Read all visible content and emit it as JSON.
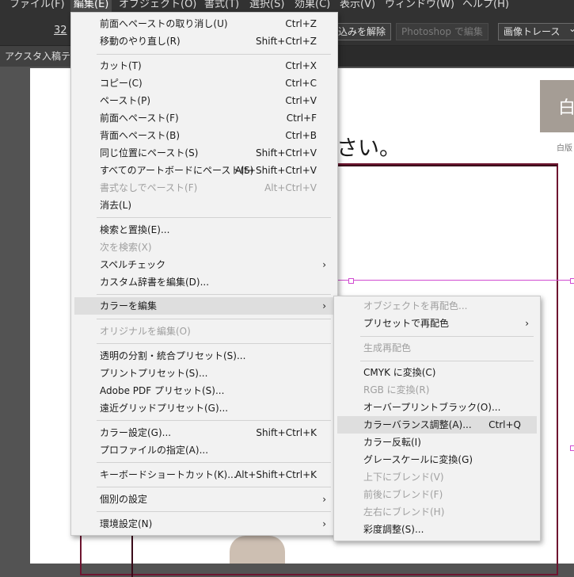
{
  "menubar": {
    "items": [
      {
        "label": "ファイル(F)"
      },
      {
        "label": "編集(E)"
      },
      {
        "label": "オブジェクト(O)"
      },
      {
        "label": "書式(T)"
      },
      {
        "label": "選択(S)"
      },
      {
        "label": "効果(C)"
      },
      {
        "label": "表示(V)"
      },
      {
        "label": "ウィンドウ(W)"
      },
      {
        "label": "ヘルプ(H)"
      }
    ]
  },
  "controlbar": {
    "number": "32",
    "release_button": "込みを解除",
    "photoshop_button": "Photoshop で編集",
    "image_trace_button": "画像トレース",
    "image_trace_arrow": "⌄"
  },
  "document_tab": {
    "title": "アクスタ入稿テン"
  },
  "artboard": {
    "heading_text": "さい。",
    "swatch_text": "白",
    "swatch_label": "白版"
  },
  "edit_menu": {
    "items": [
      {
        "label": "前面へペーストの取り消し(U)",
        "shortcut": "Ctrl+Z"
      },
      {
        "label": "移動のやり直し(R)",
        "shortcut": "Shift+Ctrl+Z"
      },
      {
        "label": "カット(T)",
        "shortcut": "Ctrl+X"
      },
      {
        "label": "コピー(C)",
        "shortcut": "Ctrl+C"
      },
      {
        "label": "ペースト(P)",
        "shortcut": "Ctrl+V"
      },
      {
        "label": "前面へペースト(F)",
        "shortcut": "Ctrl+F"
      },
      {
        "label": "背面へペースト(B)",
        "shortcut": "Ctrl+B"
      },
      {
        "label": "同じ位置にペースト(S)",
        "shortcut": "Shift+Ctrl+V"
      },
      {
        "label": "すべてのアートボードにペースト(S)",
        "shortcut": "Alt+Shift+Ctrl+V"
      },
      {
        "label": "書式なしでペースト(F)",
        "shortcut": "Alt+Ctrl+V"
      },
      {
        "label": "消去(L)",
        "shortcut": ""
      },
      {
        "label": "検索と置換(E)...",
        "shortcut": ""
      },
      {
        "label": "次を検索(X)",
        "shortcut": ""
      },
      {
        "label": "スペルチェック",
        "shortcut": ""
      },
      {
        "label": "カスタム辞書を編集(D)...",
        "shortcut": ""
      },
      {
        "label": "カラーを編集",
        "shortcut": ""
      },
      {
        "label": "オリジナルを編集(O)",
        "shortcut": ""
      },
      {
        "label": "透明の分割・統合プリセット(S)...",
        "shortcut": ""
      },
      {
        "label": "プリントプリセット(S)...",
        "shortcut": ""
      },
      {
        "label": "Adobe PDF プリセット(S)...",
        "shortcut": ""
      },
      {
        "label": "遠近グリッドプリセット(G)...",
        "shortcut": ""
      },
      {
        "label": "カラー設定(G)...",
        "shortcut": "Shift+Ctrl+K"
      },
      {
        "label": "プロファイルの指定(A)...",
        "shortcut": ""
      },
      {
        "label": "キーボードショートカット(K)...",
        "shortcut": "Alt+Shift+Ctrl+K"
      },
      {
        "label": "個別の設定",
        "shortcut": ""
      },
      {
        "label": "環境設定(N)",
        "shortcut": ""
      }
    ],
    "submenu_arrow": "›"
  },
  "color_submenu": {
    "items": [
      {
        "label": "オブジェクトを再配色..."
      },
      {
        "label": "プリセットで再配色"
      },
      {
        "label": "生成再配色"
      },
      {
        "label": "CMYK に変換(C)"
      },
      {
        "label": "RGB に変換(R)"
      },
      {
        "label": "オーバープリントブラック(O)..."
      },
      {
        "label": "カラーバランス調整(A)...",
        "shortcut": "Ctrl+Q"
      },
      {
        "label": "カラー反転(I)"
      },
      {
        "label": "グレースケールに変換(G)"
      },
      {
        "label": "上下にブレンド(V)"
      },
      {
        "label": "前後にブレンド(F)"
      },
      {
        "label": "左右にブレンド(H)"
      },
      {
        "label": "彩度調整(S)..."
      }
    ]
  }
}
